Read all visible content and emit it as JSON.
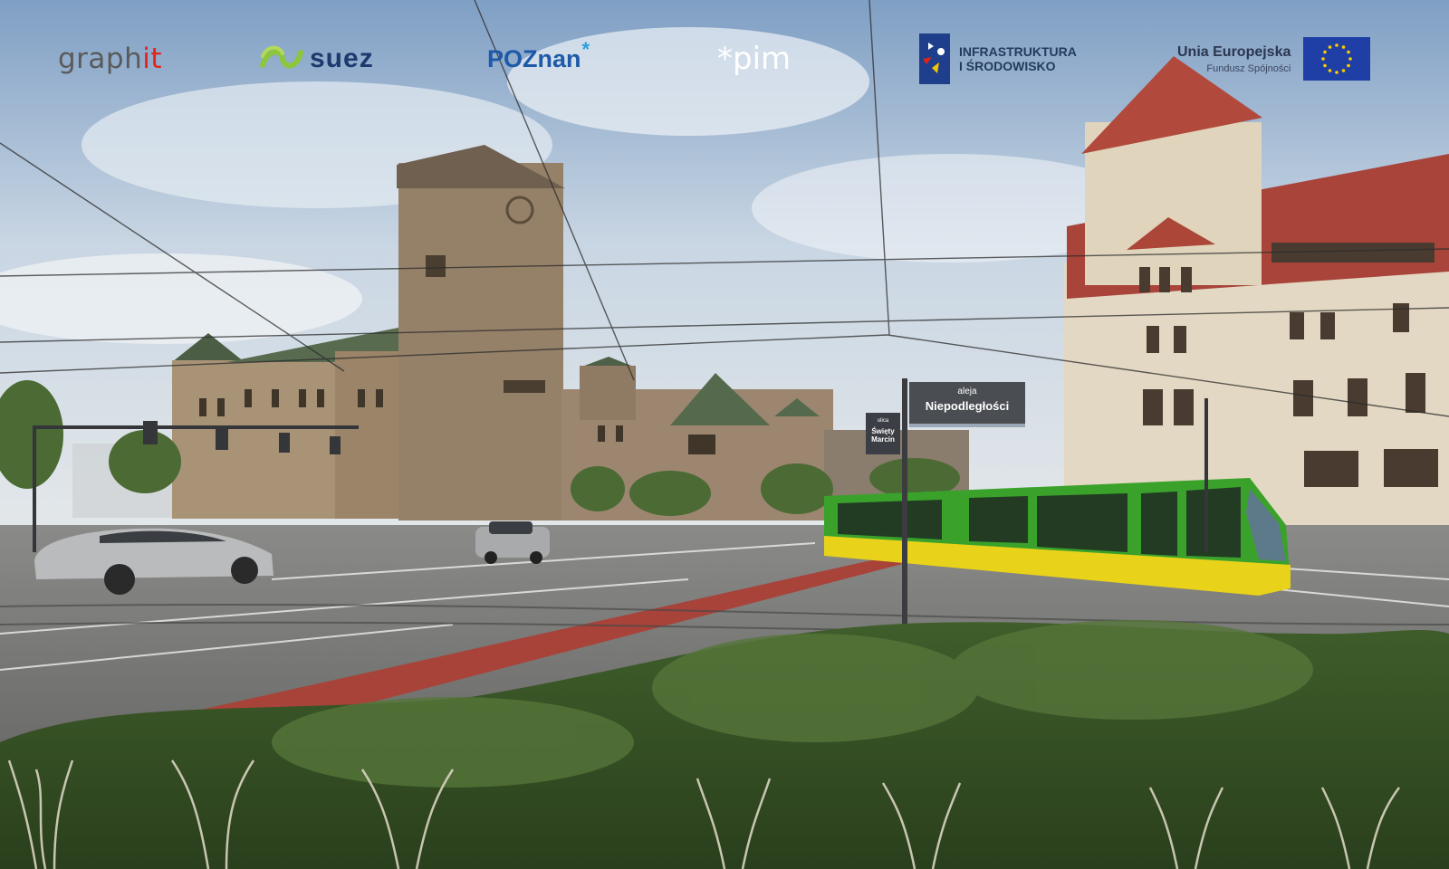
{
  "logos": {
    "graphit": {
      "prefix": "graph",
      "accent": "it"
    },
    "suez": {
      "wordmark": "suez"
    },
    "poznan": {
      "wordmark": "POZnan",
      "star": "*"
    },
    "pim": {
      "wordmark": "*pim"
    },
    "infrastruktura": {
      "line1": "INFRASTRUKTURA",
      "line2": "I ŚRODOWISKO"
    },
    "eu": {
      "title": "Unia Europejska",
      "subtitle": "Fundusz Spójności"
    }
  },
  "signs": {
    "main": {
      "prefix": "aleja",
      "name": "Niepodległości"
    },
    "side": {
      "prefix": "ulica",
      "name": "Święty Marcin"
    }
  },
  "colors": {
    "tram_green": "#3aa22b",
    "tram_yellow": "#e8d21a",
    "bike_lane": "#a8433a",
    "sky": "#a9c3de",
    "eu_blue": "#1f3fa6"
  }
}
